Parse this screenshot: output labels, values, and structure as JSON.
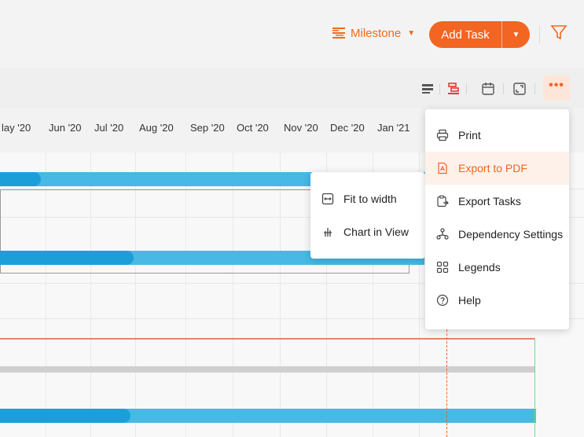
{
  "header": {
    "milestone_label": "Milestone",
    "add_task_label": "Add Task"
  },
  "timeline": {
    "months": [
      "lay '20",
      "Jun '20",
      "Jul '20",
      "Aug '20",
      "Sep '20",
      "Oct '20",
      "Nov '20",
      "Dec '20",
      "Jan '21"
    ]
  },
  "view_menu": {
    "items": [
      {
        "label": "Fit to width",
        "icon": "fit-width-icon"
      },
      {
        "label": "Chart in View",
        "icon": "chart-in-view-icon"
      }
    ]
  },
  "more_menu": {
    "items": [
      {
        "label": "Print",
        "icon": "print-icon"
      },
      {
        "label": "Export to PDF",
        "icon": "pdf-icon",
        "highlighted": true
      },
      {
        "label": "Export Tasks",
        "icon": "export-tasks-icon"
      },
      {
        "label": "Dependency Settings",
        "icon": "dependency-icon"
      },
      {
        "label": "Legends",
        "icon": "legends-icon"
      },
      {
        "label": "Help",
        "icon": "help-icon"
      }
    ]
  },
  "colors": {
    "accent": "#f26522",
    "bar_light": "#47b9e4",
    "bar_dark": "#1c9fd9"
  }
}
